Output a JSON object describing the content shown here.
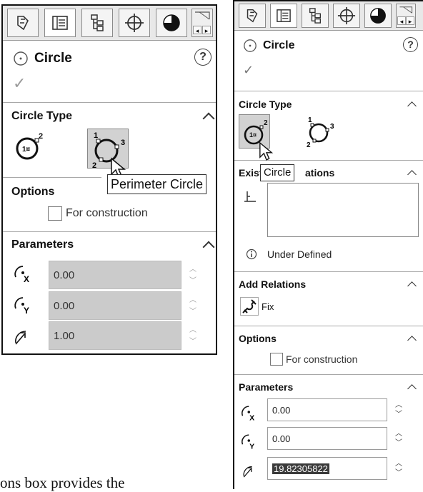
{
  "left_panel": {
    "title": "Circle",
    "help": "?",
    "sections": {
      "circle_type": "Circle Type",
      "options": "Options",
      "parameters": "Parameters"
    },
    "tooltip": "Perimeter Circle",
    "checkbox_label": "For construction",
    "params": {
      "x": "0.00",
      "y": "0.00",
      "radius": "1.00"
    },
    "circle_icon_text": "1¤",
    "perimeter_icon_numbers": [
      "1",
      "2",
      "3"
    ],
    "center_icon_number": "2"
  },
  "right_panel": {
    "title": "Circle",
    "help": "?",
    "sections": {
      "circle_type": "Circle Type",
      "existing_relations": "Exist",
      "existing_relations_tail": "ations",
      "add_relations": "Add Relations",
      "options": "Options",
      "parameters": "Parameters"
    },
    "tooltip": "Circle",
    "status": "Under Defined",
    "fix_label": "Fix",
    "checkbox_label": "For construction",
    "params": {
      "x": "0.00",
      "y": "0.00",
      "radius": "19.82305822"
    },
    "circle_icon_text": "1¤",
    "perimeter_icon_numbers": [
      "1",
      "2",
      "3"
    ],
    "center_icon_number": "2"
  },
  "bottom_text": "ons box provides the",
  "param_subscripts": {
    "x": "X",
    "y": "Y"
  }
}
